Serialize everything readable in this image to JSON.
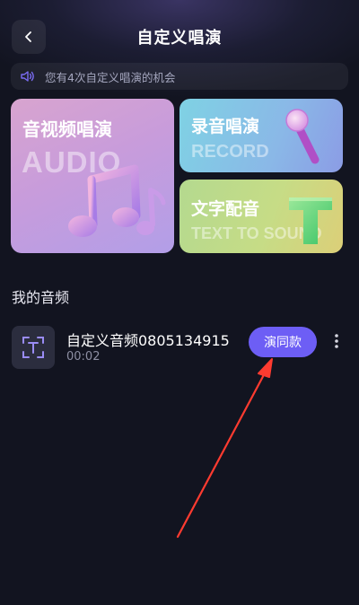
{
  "header": {
    "title": "自定义唱演",
    "back_icon": "chevron-left-icon"
  },
  "notice": {
    "icon": "speaker-icon",
    "text": "您有4次自定义唱演的机会"
  },
  "cards": {
    "audio": {
      "title": "音视频唱演",
      "watermark": "AUDIO",
      "icon": "music-note-icon"
    },
    "record": {
      "title": "录音唱演",
      "watermark": "RECORD",
      "icon": "microphone-icon"
    },
    "tts": {
      "title": "文字配音",
      "watermark": "TEXT TO SOUND",
      "icon": "letter-t-icon"
    }
  },
  "my_audio": {
    "section_title": "我的音频",
    "items": [
      {
        "name": "自定义音频0805134915",
        "duration": "00:02",
        "action_label": "演同款",
        "thumb_icon": "text-scan-icon",
        "more_icon": "more-vertical-icon"
      }
    ]
  },
  "colors": {
    "background": "#121420",
    "accent": "#6d5ef5",
    "annotation_arrow": "#ff3b30"
  }
}
